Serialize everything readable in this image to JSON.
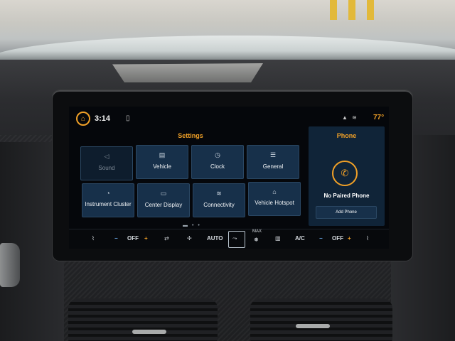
{
  "status": {
    "time": "3:14",
    "temperature": "77°",
    "icons": {
      "home": "home-icon",
      "phone": "phone-icon",
      "signal": "signal-icon",
      "wifi": "wifi-icon"
    }
  },
  "settings": {
    "title": "Settings",
    "tiles": [
      {
        "label": "Sound",
        "icon": "speaker-icon",
        "enabled": false
      },
      {
        "label": "Vehicle",
        "icon": "vehicle-icon",
        "enabled": true
      },
      {
        "label": "Clock",
        "icon": "clock-icon",
        "enabled": true
      },
      {
        "label": "General",
        "icon": "sliders-icon",
        "enabled": true
      },
      {
        "label": "Instrument Cluster",
        "icon": "gauge-icon",
        "enabled": true
      },
      {
        "label": "Center Display",
        "icon": "display-icon",
        "enabled": true
      },
      {
        "label": "Connectivity",
        "icon": "wifi-icon",
        "enabled": true
      },
      {
        "label": "Vehicle Hotspot",
        "icon": "hotspot-icon",
        "enabled": true
      }
    ]
  },
  "phone": {
    "title": "Phone",
    "status": "No Paired Phone",
    "add_label": "Add Phone"
  },
  "climate": {
    "left_off": "OFF",
    "right_off": "OFF",
    "auto": "AUTO",
    "max": "MAX",
    "ac": "A/C",
    "minus": "−",
    "plus": "+"
  },
  "colors": {
    "accent": "#f0a027",
    "tile_bg": "#17304a",
    "screen_bg": "#05070b"
  }
}
